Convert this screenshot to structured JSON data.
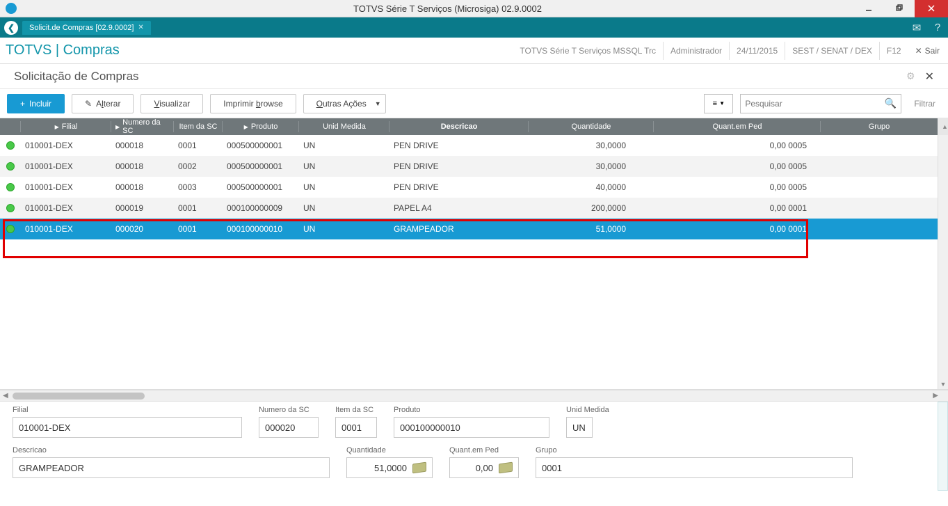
{
  "window": {
    "title": "TOTVS Série T Serviços (Microsiga) 02.9.0002"
  },
  "tabbar": {
    "tab_label": "Solicit.de Compras [02.9.0002]"
  },
  "breadcrumb": {
    "title": "TOTVS | Compras",
    "env": "TOTVS Série T Serviços MSSQL Trc",
    "user": "Administrador",
    "date": "24/11/2015",
    "org": "SEST / SENAT / DEX",
    "key": "F12",
    "exit": "Sair"
  },
  "subtitle": "Solicitação de Compras",
  "toolbar": {
    "incluir": "Incluir",
    "alterar_pre": "A",
    "alterar_u": "l",
    "alterar_post": "terar",
    "visualizar_u": "V",
    "visualizar_post": "isualizar",
    "imprimir_pre": "Imprimir ",
    "imprimir_u": "b",
    "imprimir_post": "rowse",
    "outras_u": "O",
    "outras_post": "utras Ações"
  },
  "search": {
    "placeholder": "Pesquisar",
    "filter": "Filtrar"
  },
  "columns": {
    "filial": "Filial",
    "numero": "Numero da SC",
    "item": "Item da SC",
    "produto": "Produto",
    "unid": "Unid Medida",
    "descricao": "Descricao",
    "quantidade": "Quantidade",
    "quant_ped": "Quant.em Ped",
    "grupo": "Grupo"
  },
  "rows": [
    {
      "filial": "010001-DEX",
      "num": "000018",
      "item": "0001",
      "prod": "000500000001",
      "um": "UN",
      "desc": "PEN DRIVE",
      "qtd": "30,0000",
      "qped": "0,00  0005"
    },
    {
      "filial": "010001-DEX",
      "num": "000018",
      "item": "0002",
      "prod": "000500000001",
      "um": "UN",
      "desc": "PEN DRIVE",
      "qtd": "30,0000",
      "qped": "0,00  0005"
    },
    {
      "filial": "010001-DEX",
      "num": "000018",
      "item": "0003",
      "prod": "000500000001",
      "um": "UN",
      "desc": "PEN DRIVE",
      "qtd": "40,0000",
      "qped": "0,00  0005"
    },
    {
      "filial": "010001-DEX",
      "num": "000019",
      "item": "0001",
      "prod": "000100000009",
      "um": "UN",
      "desc": "PAPEL A4",
      "qtd": "200,0000",
      "qped": "0,00  0001"
    },
    {
      "filial": "010001-DEX",
      "num": "000020",
      "item": "0001",
      "prod": "000100000010",
      "um": "UN",
      "desc": "GRAMPEADOR",
      "qtd": "51,0000",
      "qped": "0,00  0001"
    }
  ],
  "detail": {
    "labels": {
      "filial": "Filial",
      "numero": "Numero da SC",
      "item": "Item da SC",
      "produto": "Produto",
      "unid": "Unid Medida",
      "descricao": "Descricao",
      "quantidade": "Quantidade",
      "quant_ped": "Quant.em Ped",
      "grupo": "Grupo"
    },
    "values": {
      "filial": "010001-DEX",
      "numero": "000020",
      "item": "0001",
      "produto": "000100000010",
      "unid": "UN",
      "descricao": "GRAMPEADOR",
      "quantidade": "51,0000",
      "quant_ped": "0,00",
      "grupo": "0001"
    }
  }
}
